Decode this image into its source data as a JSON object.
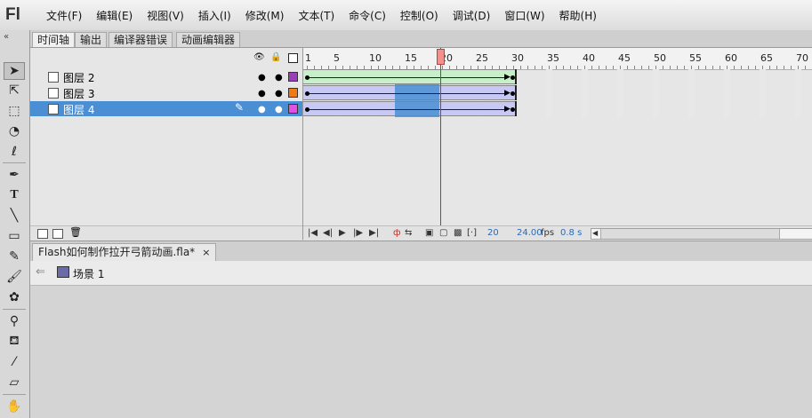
{
  "app": {
    "logo": "Fl"
  },
  "menu": [
    "文件(F)",
    "编辑(E)",
    "视图(V)",
    "插入(I)",
    "修改(M)",
    "文本(T)",
    "命令(C)",
    "控制(O)",
    "调试(D)",
    "窗口(W)",
    "帮助(H)"
  ],
  "toolbar": {
    "collapse": "«"
  },
  "tabs": [
    "时间轴",
    "输出",
    "编译器错误",
    "动画编辑器"
  ],
  "layers": [
    {
      "name": "图层 2",
      "color": "#9b3fb8"
    },
    {
      "name": "图层 3",
      "color": "#f07b12"
    },
    {
      "name": "图层 4",
      "color": "#e24fe2",
      "selected": true
    }
  ],
  "ruler": {
    "labels": [
      "1",
      "5",
      "10",
      "15",
      "20",
      "25",
      "30",
      "35",
      "40",
      "45",
      "50",
      "55",
      "60",
      "65",
      "70"
    ]
  },
  "frame_status": {
    "current_frame": "20",
    "fps": "24.00",
    "fps_unit": "fps",
    "time": "0.8 s"
  },
  "document": {
    "tab_title": "Flash如何制作拉开弓箭动画.fla*",
    "close": "×",
    "scene": "场景 1"
  },
  "colors": {
    "tween_green": "#c8f0c8",
    "tween_blue": "#c8c8f5",
    "selection": "#4a8fd3",
    "playhead": "#e02020"
  }
}
